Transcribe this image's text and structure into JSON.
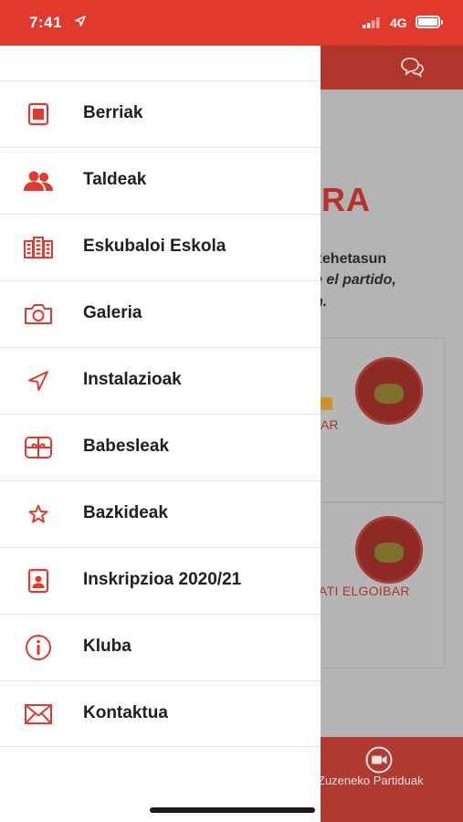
{
  "status_bar": {
    "time": "7:41",
    "network": "4G",
    "accent": "#e03a2f"
  },
  "background": {
    "title_fragment": "RA",
    "text_line1": "xehetasun",
    "text_line2": "e el partido,",
    "text_line3": "n.",
    "card1_text": "AR",
    "card2_text": "ATI ELGOIBAR",
    "bottom_tab_label": "Zuzeneko Partiduak"
  },
  "drawer": {
    "icon_color": "#e03a2f",
    "items": [
      {
        "label": "Berriak",
        "icon": "news-icon"
      },
      {
        "label": "Taldeak",
        "icon": "people-icon"
      },
      {
        "label": "Eskubaloi Eskola",
        "icon": "building-icon"
      },
      {
        "label": "Galeria",
        "icon": "camera-icon"
      },
      {
        "label": "Instalazioak",
        "icon": "location-arrow-icon"
      },
      {
        "label": "Babesleak",
        "icon": "gift-icon"
      },
      {
        "label": "Bazkideak",
        "icon": "star-icon"
      },
      {
        "label": "Inskripzioa 2020/21",
        "icon": "contact-card-icon"
      },
      {
        "label": "Kluba",
        "icon": "info-icon"
      },
      {
        "label": "Kontaktua",
        "icon": "envelope-icon"
      }
    ]
  }
}
